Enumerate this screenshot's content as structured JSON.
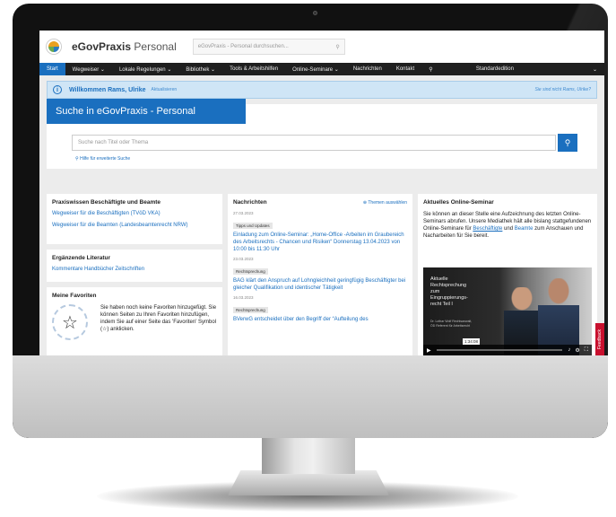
{
  "header": {
    "brand": "eGovPraxis",
    "edition": "Personal",
    "search_placeholder": "eGovPraxis - Personal durchsuchen..."
  },
  "nav": {
    "items": [
      {
        "label": "Start"
      },
      {
        "label": "Wegweiser ⌄"
      },
      {
        "label": "Lokale Regelungen ⌄"
      },
      {
        "label": "Bibliothek ⌄"
      },
      {
        "label": "Tools & Arbeitshilfen"
      },
      {
        "label": "Online-Seminare ⌄"
      },
      {
        "label": "Nachrichten"
      },
      {
        "label": "Kontakt"
      }
    ],
    "edition_select": "Standardedition"
  },
  "welcome": {
    "text": "Willkommen Rams, Ulrike",
    "update_link": "Aktualisieren",
    "not_you": "Sie sind nicht Rams, Ulrike?"
  },
  "search": {
    "title": "Suche in eGovPraxis - Personal",
    "placeholder": "Suche nach Titel oder Thema",
    "advanced": "Hilfe für erweiterte Suche"
  },
  "practice": {
    "title": "Praxiswissen Beschäftigte und Beamte",
    "links": [
      "Wegweiser für die Beschäftigten (TVöD VKA)",
      "Wegweiser für die Beamten (Landesbeamtenrecht NRW)"
    ]
  },
  "literature": {
    "title": "Ergänzende Literatur",
    "link": "Kommentare Handbücher Zeitschriften"
  },
  "favorites": {
    "title": "Meine Favoriten",
    "text": "Sie haben noch keine Favoriten hinzugefügt. Sie können Seiten zu Ihren Favoriten hinzufügen, indem Sie auf einer Seite das 'Favoriten' Symbol (☆) anklicken."
  },
  "news": {
    "title": "Nachrichten",
    "themes_link": "Themen auswählen",
    "items": [
      {
        "date": "27.03.2023",
        "tag": "Tipps und Updates",
        "title": "Einladung zum Online-Seminar: „Home-Office -Arbeiten im Graubereich des Arbeitsrechts - Chancen und Risiken“ Donnerstag 13.04.2023 von 10:00 bis 11:30 Uhr"
      },
      {
        "date": "23.03.2023",
        "tag": "Rechtsprechung",
        "title": "BAG klärt den Anspruch auf Lohngleichheit geringfügig Beschäftigter bei gleicher Qualifikation und identischer Tätigkeit"
      },
      {
        "date": "16.03.2023",
        "tag": "Rechtsprechung",
        "title": "BVerwG entscheidet über den Begriff der “Aufteilung des"
      }
    ]
  },
  "seminar": {
    "title": "Aktuelles Online-Seminar",
    "text_1": "Sie können an dieser Stelle eine Aufzeichnung des letzten Online-Seminars abrufen. Unsere Mediathek hält alle bislang stattgefundenen Online-Seminare für ",
    "link_1": "Beschäftigte",
    "text_2": " und ",
    "link_2": "Beamte",
    "text_3": " zum Anschauen und Nacharbeiten für Sie bereit.",
    "video_title": "Aktuelle Rechtsprechung zum Eingruppierungs-recht Teil I",
    "video_meta": "Dr. Lothar Wolf Rechtsanwalt, ÖD Referent für Arbeitsrecht",
    "video_time": "1:34:08"
  },
  "feedback": "Feedback"
}
